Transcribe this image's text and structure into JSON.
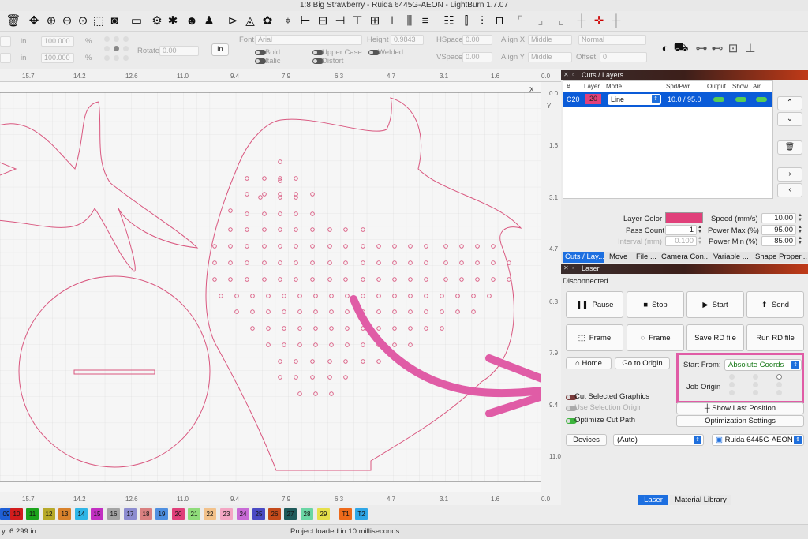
{
  "window": {
    "title": "1:8 Big Strawberry - Ruida 6445G-AEON - LightBurn 1.7.07"
  },
  "toolbar2": {
    "in_label": "in",
    "pct_label": "%",
    "width_value": "100.000",
    "height_value": "100.000",
    "rotate_label": "Rotate",
    "rotate_value": "0.00",
    "units_button": "in",
    "font_label": "Font",
    "font_value": "Arial",
    "height_label": "Height",
    "height_text_value": "0.9843",
    "hspace_label": "HSpace",
    "hspace_value": "0.00",
    "vspace_label": "VSpace",
    "vspace_value": "0.00",
    "align_x_label": "Align X",
    "align_x_value": "Middle",
    "align_y_label": "Align Y",
    "align_y_value": "Middle",
    "style_value": "Normal",
    "offset_label": "Offset",
    "offset_value": "0",
    "bold_label": "Bold",
    "italic_label": "Italic",
    "upper_label": "Upper Case",
    "distort_label": "Distort",
    "welded_label": "Welded"
  },
  "rulers": {
    "top": [
      "15.7",
      "14.2",
      "12.6",
      "11.0",
      "9.4",
      "7.9",
      "6.3",
      "4.7",
      "3.1",
      "1.6",
      "0.0"
    ],
    "right": [
      "0.0",
      "1.6",
      "3.1",
      "4.7",
      "6.3",
      "7.9",
      "9.4",
      "11.0"
    ],
    "x_label": "X",
    "y_label": "Y"
  },
  "palette": [
    {
      "label": "09",
      "color": "#1f5fd6"
    },
    {
      "label": "10",
      "color": "#d21c1c"
    },
    {
      "label": "11",
      "color": "#1ca41c"
    },
    {
      "label": "12",
      "color": "#b7a92a"
    },
    {
      "label": "13",
      "color": "#d9822b"
    },
    {
      "label": "14",
      "color": "#2fb5e6"
    },
    {
      "label": "15",
      "color": "#c22fc2"
    },
    {
      "label": "16",
      "color": "#a4a4a4"
    },
    {
      "label": "17",
      "color": "#8c8cd0"
    },
    {
      "label": "18",
      "color": "#d98080"
    },
    {
      "label": "19",
      "color": "#4f8fe0"
    },
    {
      "label": "20",
      "color": "#e0407a"
    },
    {
      "label": "21",
      "color": "#8fdc7a"
    },
    {
      "label": "22",
      "color": "#f2c18a"
    },
    {
      "label": "23",
      "color": "#f4a6c4"
    },
    {
      "label": "24",
      "color": "#c86ad6"
    },
    {
      "label": "25",
      "color": "#4a4ac4"
    },
    {
      "label": "26",
      "color": "#c44a1a"
    },
    {
      "label": "27",
      "color": "#1f5a5a"
    },
    {
      "label": "28",
      "color": "#6ad6a4"
    },
    {
      "label": "29",
      "color": "#e6e04a"
    },
    {
      "label": "T1",
      "color": "#ee6a1a"
    },
    {
      "label": "T2",
      "color": "#2fa6e6"
    }
  ],
  "status": {
    "position": "y: 6.299 in",
    "message": "Project loaded in 10 milliseconds"
  },
  "cuts": {
    "title": "Cuts / Layers",
    "headers": [
      "#",
      "Layer",
      "Mode",
      "Spd/Pwr",
      "Output",
      "Show",
      "Air"
    ],
    "row": {
      "id": "C20",
      "layer": "20",
      "layer_color": "#e0407a",
      "mode": "Line",
      "spdpwr": "10.0 / 95.0"
    },
    "layer_color_label": "Layer Color",
    "pass_count_label": "Pass Count",
    "pass_count_value": "1",
    "interval_label": "Interval (mm)",
    "interval_value": "0.100",
    "speed_label": "Speed (mm/s)",
    "speed_value": "10.00",
    "power_max_label": "Power Max (%)",
    "power_max_value": "95.00",
    "power_min_label": "Power Min (%)",
    "power_min_value": "85.00",
    "tabs": [
      "Cuts / Lay...",
      "Move",
      "File ...",
      "Camera Con...",
      "Variable ...",
      "Shape Proper..."
    ]
  },
  "laser": {
    "title": "Laser",
    "status": "Disconnected",
    "pause": "Pause",
    "stop": "Stop",
    "start": "Start",
    "send": "Send",
    "frame1": "Frame",
    "frame2": "Frame",
    "save_rd": "Save RD file",
    "run_rd": "Run RD file",
    "home": "Home",
    "go_origin": "Go to Origin",
    "start_from_label": "Start From:",
    "start_from_value": "Absolute Coords",
    "job_origin_label": "Job Origin",
    "cut_selected": "Cut Selected Graphics",
    "use_selection_origin": "Use Selection Origin",
    "optimize_cut": "Optimize Cut Path",
    "show_last": "Show Last Position",
    "optimization_settings": "Optimization Settings",
    "devices": "Devices",
    "port_value": "(Auto)",
    "device_value": "Ruida 6445G-AEON",
    "bottom_tabs": [
      "Laser",
      "Material Library"
    ]
  }
}
